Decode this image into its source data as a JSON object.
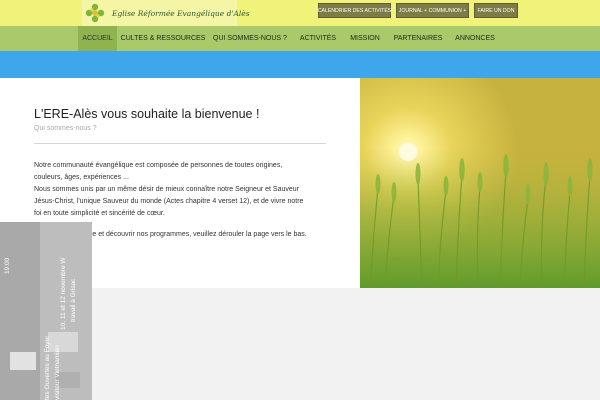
{
  "header": {
    "logo_text": "Eglise Réformée Evangélique d'Alès",
    "buttons": [
      "CALENDRIER DES ACTIVITÉS",
      "JOURNAL + COMMUNION +",
      "FAIRE UN DON"
    ]
  },
  "nav": {
    "items": [
      "ACCUEIL",
      "CULTES & RESSOURCES",
      "QUI SOMMES-NOUS ?",
      "ACTIVITÉS",
      "MISSION",
      "PARTENAIRES",
      "ANNONCES"
    ],
    "active": "ACCUEIL"
  },
  "main": {
    "title": "L'ERE-Alès vous souhaite la bienvenue !",
    "subtitle": "Qui sommes-nous ?",
    "lines": [
      "Notre communauté évangélique est composée de personnes de toutes origines,",
      "couleurs, âges, expériences ...",
      "Nous sommes unis par un même désir de mieux connaître notre Seigneur et Sauveur",
      "Jésus-Christ, l'unique Sauveur du monde (Actes chapitre 4 verset 12), et de vivre notre",
      "foi en toute simplicité et sincérité de cœur.",
      "Pour explorer le site et découvrir nos programmes, veuillez dérouler la page vers le bas."
    ]
  },
  "poster": {
    "lines": [
      "19:00",
      "10, 11 et 12 novembre W",
      "travail à Grisac",
      "tes Ouvertes au Foyer",
      "visiteur Vietnamien"
    ]
  },
  "colors": {
    "topbar": "#f0f27a",
    "navbar": "#a9c96a",
    "nav_active": "#8eb34f",
    "blue_band": "#3ea7ec",
    "button": "#7d7c44"
  }
}
